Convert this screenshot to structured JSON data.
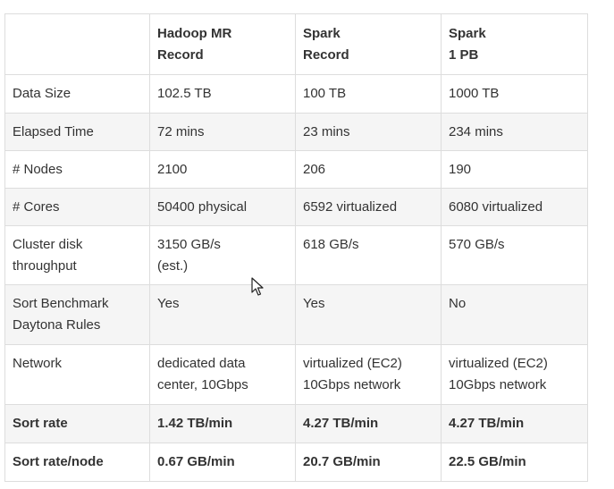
{
  "table": {
    "header": {
      "col0": "",
      "col1": [
        "Hadoop MR",
        "Record"
      ],
      "col2": [
        "Spark",
        "Record"
      ],
      "col3": [
        "Spark",
        "1 PB"
      ]
    },
    "rows": [
      {
        "label": [
          "Data Size"
        ],
        "c1": [
          "102.5 TB"
        ],
        "c2": [
          "100 TB"
        ],
        "c3": [
          "1000 TB"
        ]
      },
      {
        "label": [
          "Elapsed Time"
        ],
        "c1": [
          "72 mins"
        ],
        "c2": [
          "23 mins"
        ],
        "c3": [
          "234 mins"
        ]
      },
      {
        "label": [
          "# Nodes"
        ],
        "c1": [
          "2100"
        ],
        "c2": [
          "206"
        ],
        "c3": [
          "190"
        ]
      },
      {
        "label": [
          "# Cores"
        ],
        "c1": [
          "50400 physical"
        ],
        "c2": [
          "6592 virtualized"
        ],
        "c3": [
          "6080 virtualized"
        ]
      },
      {
        "label": [
          "Cluster disk",
          "throughput"
        ],
        "c1": [
          "3150 GB/s",
          "(est.)"
        ],
        "c2": [
          "618 GB/s"
        ],
        "c3": [
          "570 GB/s"
        ]
      },
      {
        "label": [
          "Sort Benchmark",
          "Daytona Rules"
        ],
        "c1": [
          "Yes"
        ],
        "c2": [
          "Yes"
        ],
        "c3": [
          "No"
        ]
      },
      {
        "label": [
          "Network"
        ],
        "c1": [
          "dedicated data",
          "center, 10Gbps"
        ],
        "c2": [
          "virtualized (EC2)",
          "10Gbps network"
        ],
        "c3": [
          "virtualized (EC2)",
          "10Gbps network"
        ]
      },
      {
        "label": [
          "Sort rate"
        ],
        "c1": [
          "1.42 TB/min"
        ],
        "c2": [
          "4.27 TB/min"
        ],
        "c3": [
          "4.27 TB/min"
        ]
      },
      {
        "label": [
          "Sort rate/node"
        ],
        "c1": [
          "0.67 GB/min"
        ],
        "c2": [
          "20.7 GB/min"
        ],
        "c3": [
          "22.5 GB/min"
        ]
      }
    ]
  },
  "cursor_icon": "mouse-pointer-icon"
}
